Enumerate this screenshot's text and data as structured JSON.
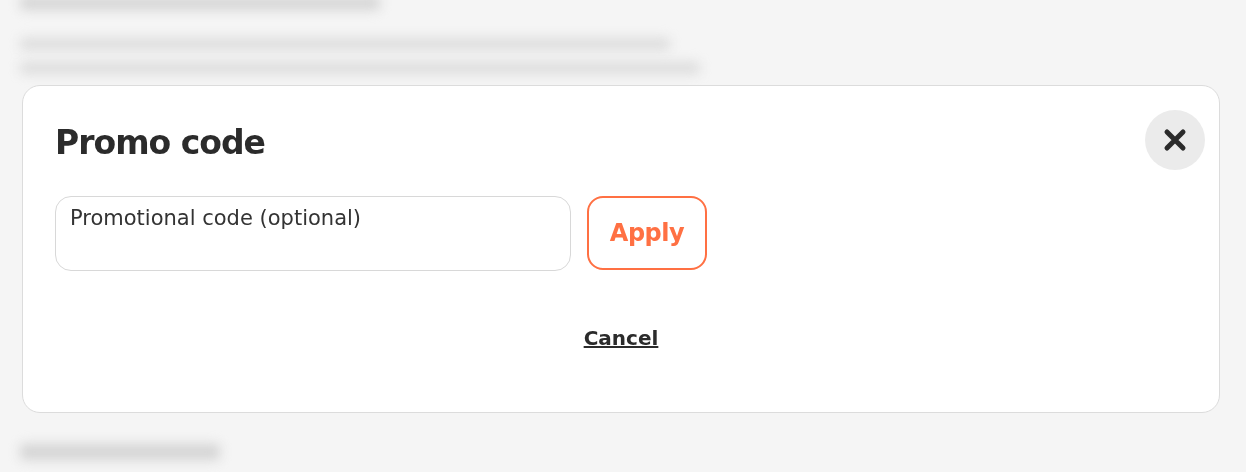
{
  "dialog": {
    "title": "Promo code",
    "promo_field": {
      "placeholder": "Promotional code (optional)"
    },
    "apply_button": {
      "label": "Apply"
    },
    "cancel_link": {
      "label": "Cancel"
    }
  }
}
